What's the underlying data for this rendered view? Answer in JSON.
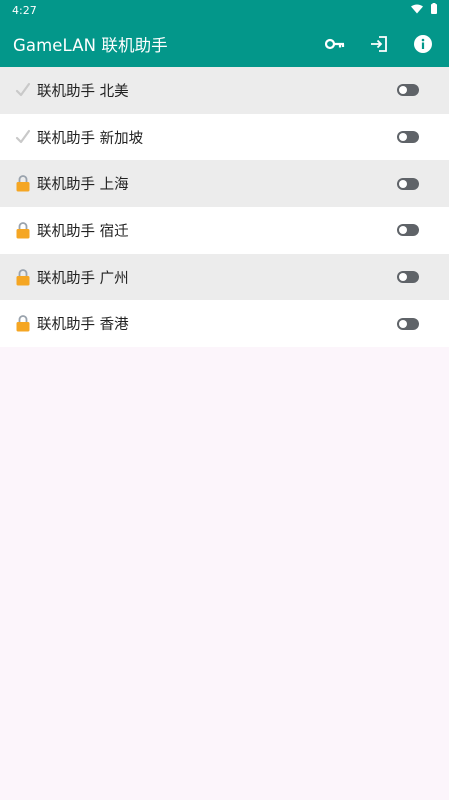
{
  "status_bar": {
    "time": "4:27",
    "wifi_icon": "wifi-icon",
    "battery_icon": "battery-icon"
  },
  "app_bar": {
    "title": "GameLAN 联机助手",
    "actions": [
      {
        "icon": "key-icon"
      },
      {
        "icon": "login-icon"
      },
      {
        "icon": "info-icon"
      }
    ]
  },
  "colors": {
    "primary": "#03978a",
    "row_alt": "#ececec",
    "background": "#fcf5fb",
    "lock": "#f5a623"
  },
  "servers": [
    {
      "label": "联机助手 北美",
      "icon": "checkmark-icon",
      "enabled": false
    },
    {
      "label": "联机助手 新加坡",
      "icon": "checkmark-icon",
      "enabled": false
    },
    {
      "label": "联机助手 上海",
      "icon": "lock-icon",
      "enabled": false
    },
    {
      "label": "联机助手 宿迁",
      "icon": "lock-icon",
      "enabled": false
    },
    {
      "label": "联机助手 广州",
      "icon": "lock-icon",
      "enabled": false
    },
    {
      "label": "联机助手 香港",
      "icon": "lock-icon",
      "enabled": false
    }
  ]
}
